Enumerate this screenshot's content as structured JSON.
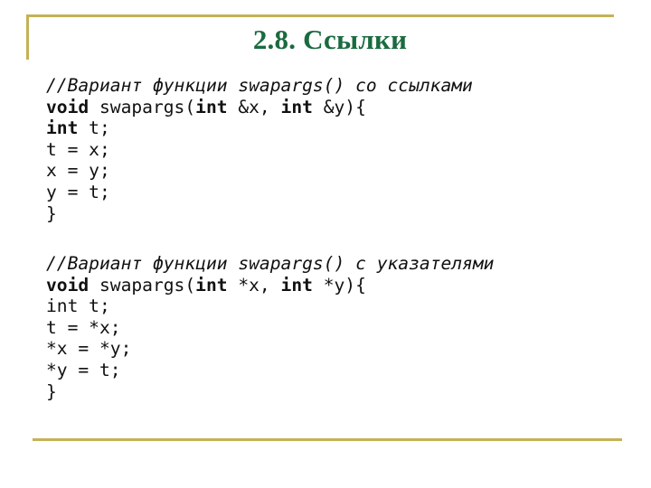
{
  "slide": {
    "title": "2.8. Ссылки",
    "colors": {
      "title": "#1a6b3f",
      "rule": "#c4b255",
      "text": "#111111",
      "background": "#ffffff"
    },
    "blocks": [
      {
        "lines": [
          [
            {
              "t": "//Вариант функции swapargs() со ссылками",
              "s": "cm"
            }
          ],
          [
            {
              "t": "void",
              "s": "kw"
            },
            {
              "t": " swapargs(",
              "s": ""
            },
            {
              "t": "int",
              "s": "kw"
            },
            {
              "t": " &x, ",
              "s": ""
            },
            {
              "t": "int",
              "s": "kw"
            },
            {
              "t": " &y){",
              "s": ""
            }
          ],
          [
            {
              "t": "int",
              "s": "kw"
            },
            {
              "t": " t;",
              "s": ""
            }
          ],
          [
            {
              "t": "t = x;",
              "s": ""
            }
          ],
          [
            {
              "t": "x = y;",
              "s": ""
            }
          ],
          [
            {
              "t": "y = t;",
              "s": ""
            }
          ],
          [
            {
              "t": "}",
              "s": ""
            }
          ]
        ]
      },
      {
        "lines": [
          [
            {
              "t": "//Вариант функции swapargs() с указателями",
              "s": "cm"
            }
          ],
          [
            {
              "t": "void",
              "s": "kw"
            },
            {
              "t": " swapargs(",
              "s": ""
            },
            {
              "t": "int",
              "s": "kw"
            },
            {
              "t": " *x, ",
              "s": ""
            },
            {
              "t": "int",
              "s": "kw"
            },
            {
              "t": " *y){",
              "s": ""
            }
          ],
          [
            {
              "t": "int t;",
              "s": ""
            }
          ],
          [
            {
              "t": "t = *x;",
              "s": ""
            }
          ],
          [
            {
              "t": "*x = *y;",
              "s": ""
            }
          ],
          [
            {
              "t": "*y = t;",
              "s": ""
            }
          ],
          [
            {
              "t": "}",
              "s": ""
            }
          ]
        ]
      }
    ]
  }
}
